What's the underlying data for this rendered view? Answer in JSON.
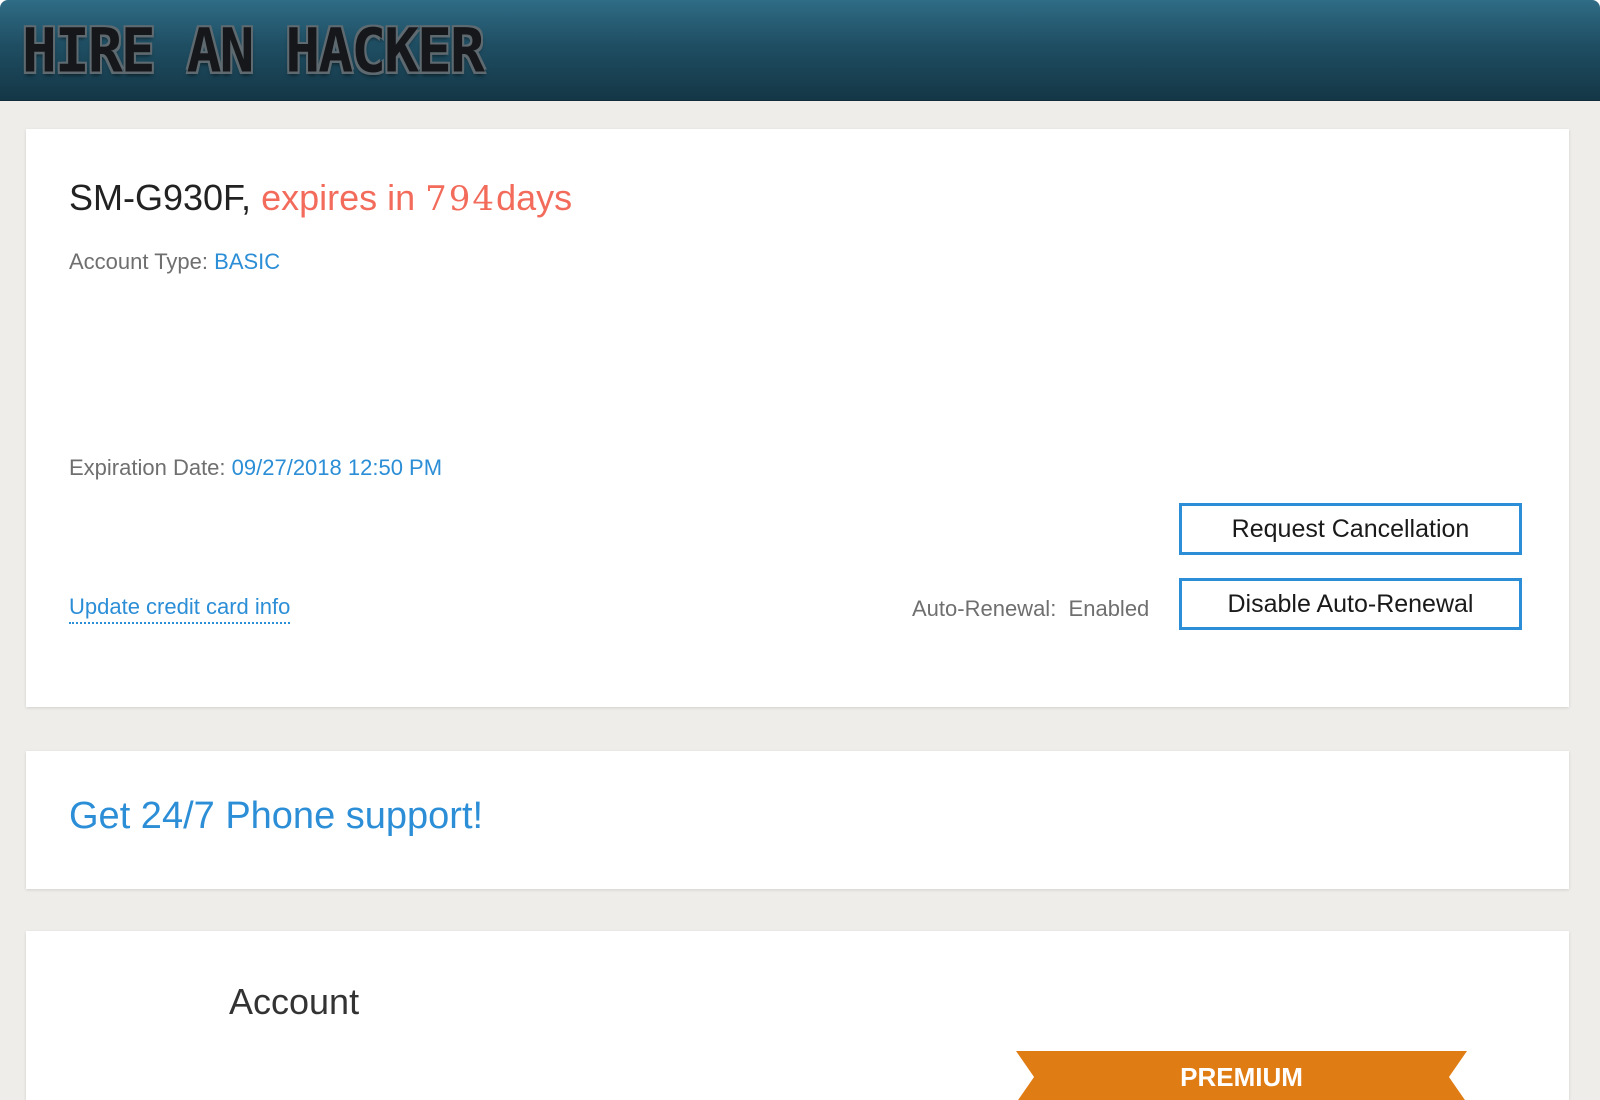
{
  "header": {
    "logo_text": "HIRE AN HACKER"
  },
  "device_card": {
    "device_name": "SM-G930F,",
    "expires_prefix": "expires in",
    "days_remaining": "794",
    "days_suffix": "days",
    "account_type_label": "Account Type:",
    "account_type_value": "BASIC",
    "expiration_label": "Expiration Date:",
    "expiration_value": "09/27/2018 12:50 PM",
    "update_link": "Update credit card info",
    "auto_renewal_label": "Auto-Renewal:",
    "auto_renewal_value": "Enabled",
    "request_cancellation_button": "Request Cancellation",
    "disable_auto_renewal_button": "Disable Auto-Renewal"
  },
  "support_card": {
    "title": "Get 24/7 Phone support!"
  },
  "account_card": {
    "title": "Account",
    "ribbon": "PREMIUM"
  },
  "colors": {
    "accent_blue": "#2b8ed6",
    "expiry_red": "#f26b5b",
    "ribbon_orange": "#e07c14",
    "header_teal": "#1f4e63"
  }
}
